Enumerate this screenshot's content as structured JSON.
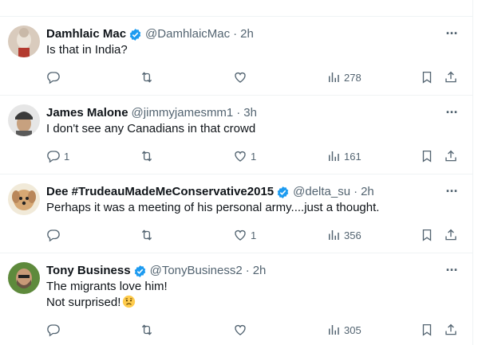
{
  "posts": [
    {
      "name": "Damhlaic Mac",
      "handle": "@DamhlaicMac",
      "time": "2h",
      "text": "Is that in India?",
      "replies": "",
      "retweets": "",
      "likes": "",
      "views": "278",
      "verified": true
    },
    {
      "name": "James Malone",
      "handle": "@jimmyjamesmm1",
      "time": "3h",
      "text": "I don't see any Canadians in that crowd",
      "replies": "1",
      "retweets": "",
      "likes": "1",
      "views": "161",
      "verified": false
    },
    {
      "name": "Dee #TrudeauMadeMeConservative2015",
      "handle": "@delta_su",
      "time": "2h",
      "text": "Perhaps it was a meeting of his personal army....just a thought.",
      "replies": "",
      "retweets": "",
      "likes": "1",
      "views": "356",
      "verified": true
    },
    {
      "name": "Tony Business",
      "handle": "@TonyBusiness2",
      "time": "2h",
      "text_line1": "The migrants love him!",
      "text_line2": "Not surprised!",
      "emoji": "worried-face-emoji",
      "replies": "",
      "retweets": "",
      "likes": "",
      "views": "305",
      "verified": true
    }
  ],
  "dot": "·",
  "more_label": "···",
  "colors": {
    "verified": "#1d9bf0",
    "muted": "#536471",
    "text": "#0f1419",
    "border": "#eff3f4"
  }
}
